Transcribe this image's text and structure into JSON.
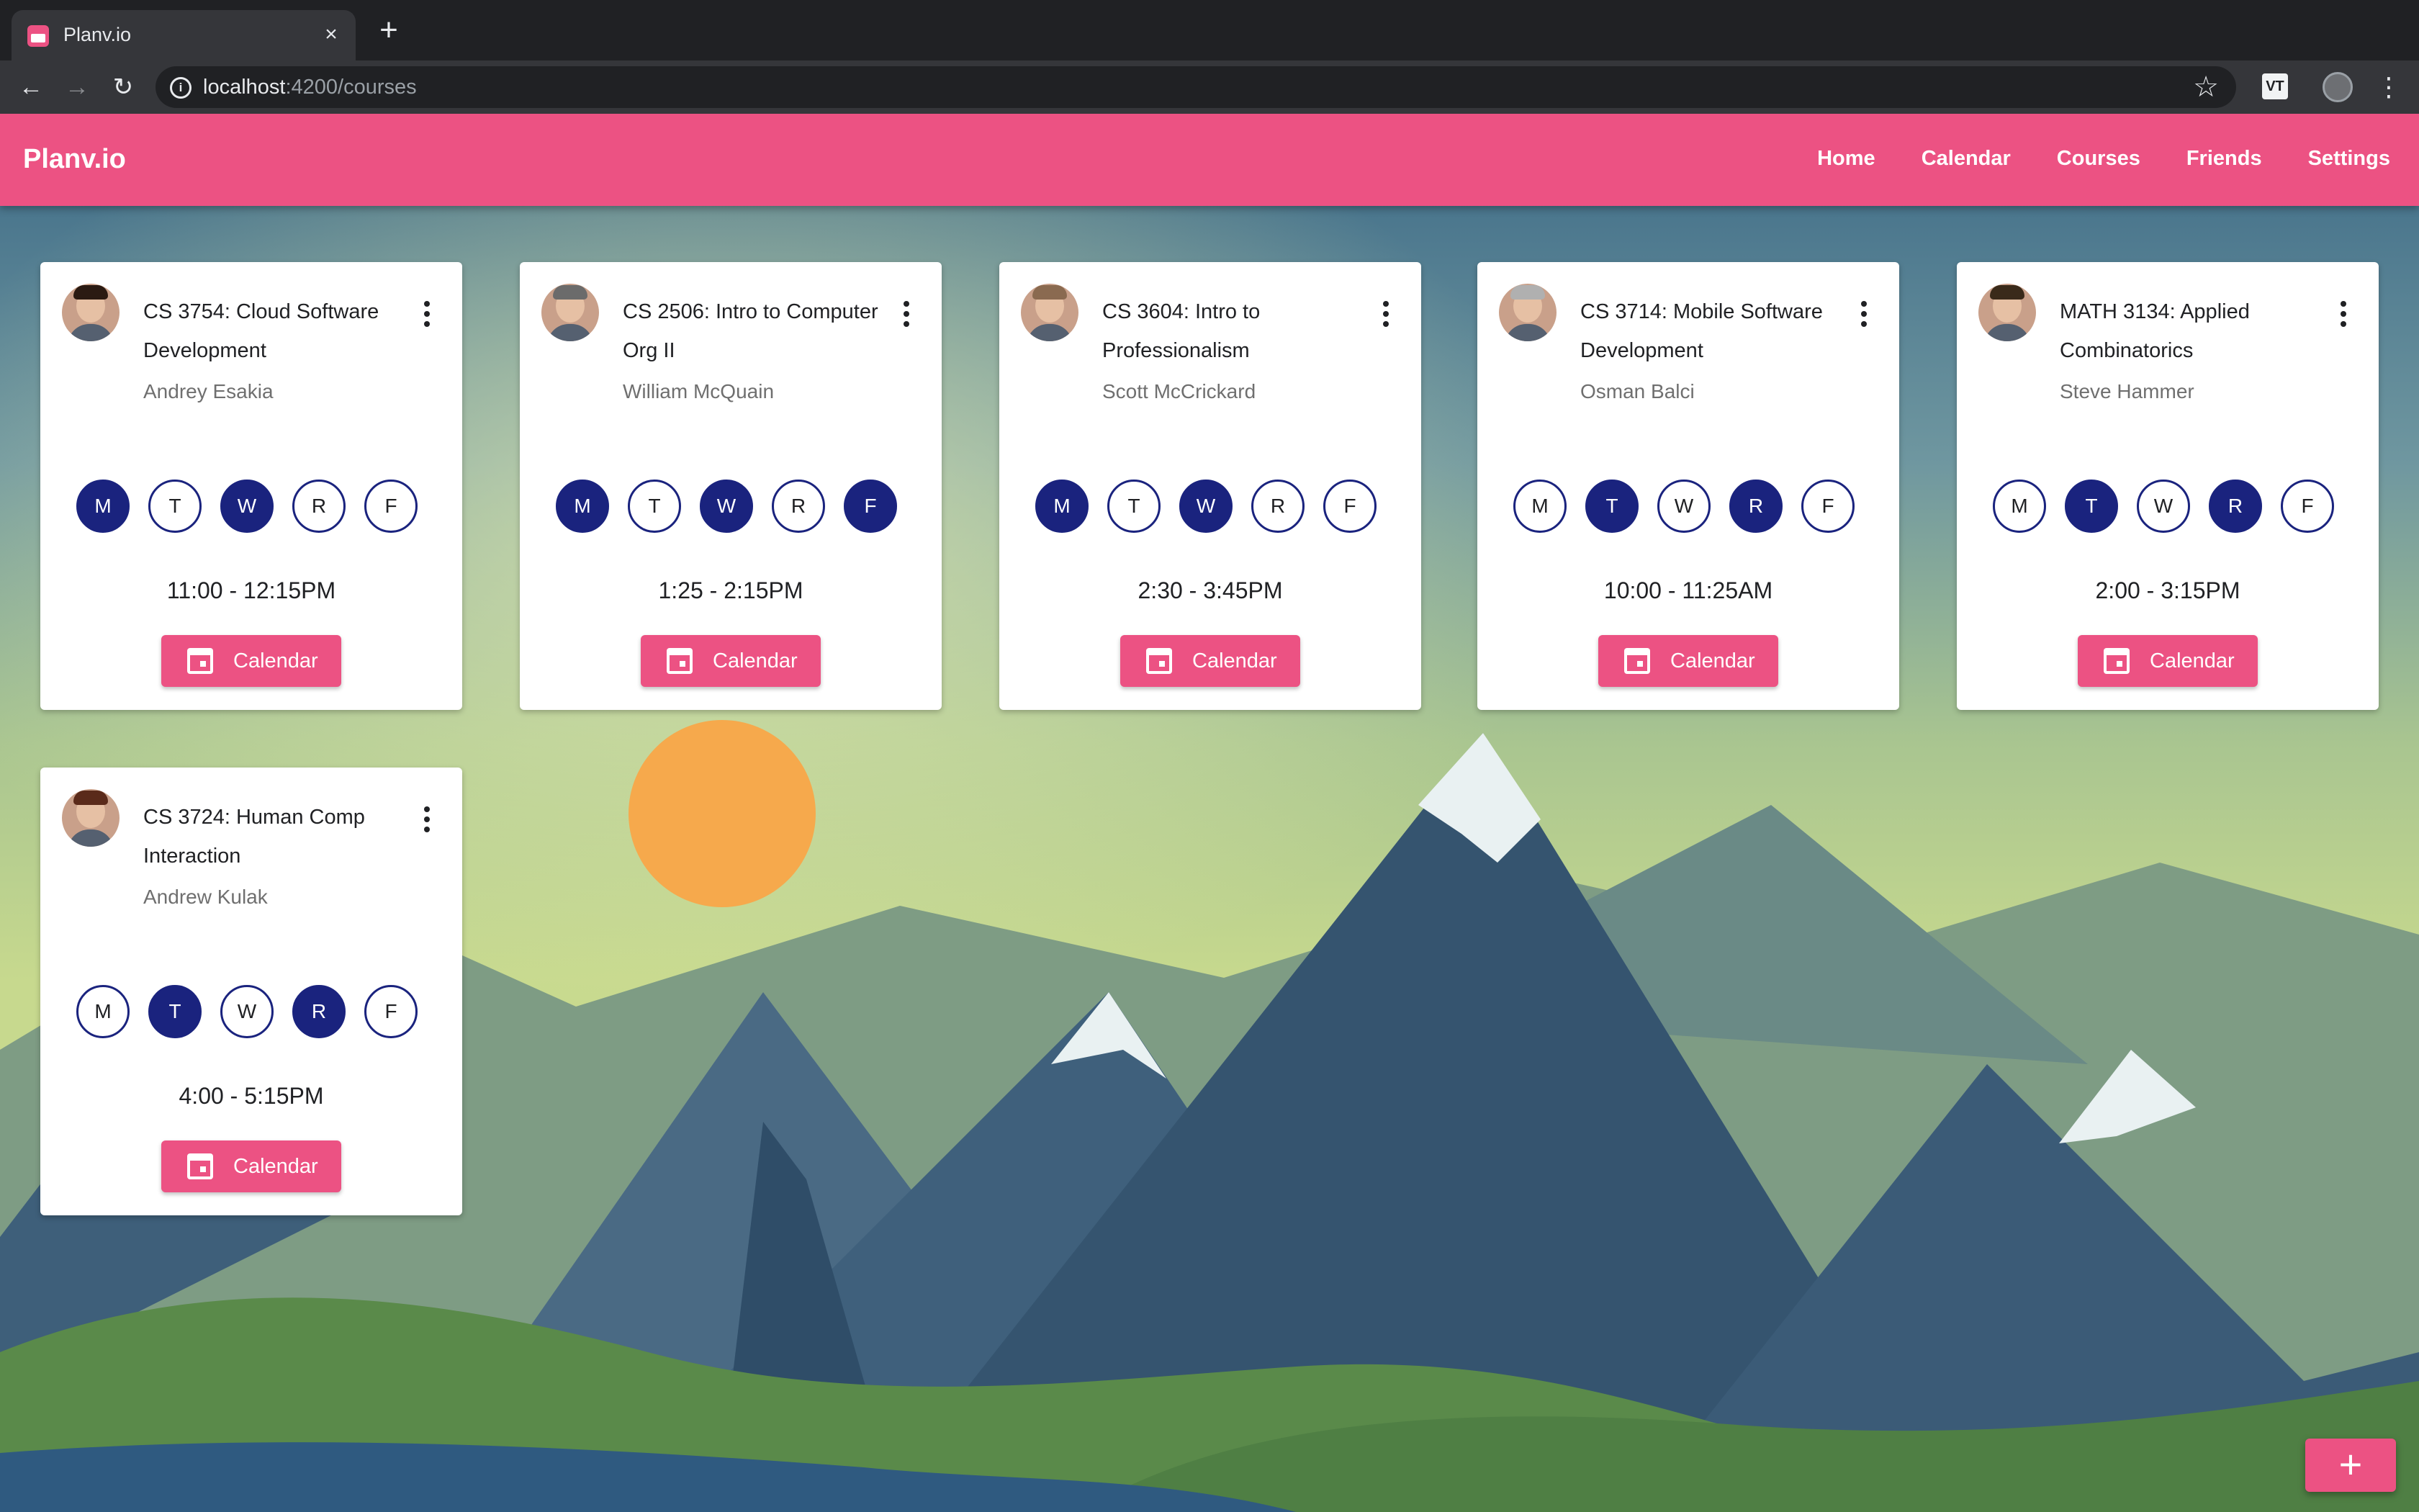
{
  "browser": {
    "tab_title": "Planv.io",
    "tab_close": "×",
    "new_tab": "+",
    "url_host": "localhost",
    "url_path": ":4200/courses",
    "ext_label": "VT"
  },
  "app": {
    "brand": "Planv.io",
    "nav": [
      "Home",
      "Calendar",
      "Courses",
      "Friends",
      "Settings"
    ],
    "colors": {
      "primary": "#ec5283",
      "day_active": "#1a237e"
    }
  },
  "days": [
    "M",
    "T",
    "W",
    "R",
    "F"
  ],
  "courses": [
    {
      "title": "CS 3754: Cloud Software Development",
      "instructor": "Andrey Esakia",
      "active_days": [
        true,
        false,
        true,
        false,
        false
      ],
      "time": "11:00 - 12:15PM",
      "button": "Calendar"
    },
    {
      "title": "CS 2506: Intro to Computer Org II",
      "instructor": "William McQuain",
      "active_days": [
        true,
        false,
        true,
        false,
        true
      ],
      "time": "1:25 - 2:15PM",
      "button": "Calendar"
    },
    {
      "title": "CS 3604: Intro to Professionalism",
      "instructor": "Scott McCrickard",
      "active_days": [
        true,
        false,
        true,
        false,
        false
      ],
      "time": "2:30 - 3:45PM",
      "button": "Calendar"
    },
    {
      "title": "CS 3714: Mobile Software Development",
      "instructor": "Osman Balci",
      "active_days": [
        false,
        true,
        false,
        true,
        false
      ],
      "time": "10:00 - 11:25AM",
      "button": "Calendar"
    },
    {
      "title": "MATH 3134: Applied Combinatorics",
      "instructor": "Steve Hammer",
      "active_days": [
        false,
        true,
        false,
        true,
        false
      ],
      "time": "2:00 - 3:15PM",
      "button": "Calendar"
    },
    {
      "title": "CS 3724: Human Comp Interaction",
      "instructor": "Andrew Kulak",
      "active_days": [
        false,
        true,
        false,
        true,
        false
      ],
      "time": "4:00 - 5:15PM",
      "button": "Calendar"
    }
  ],
  "fab_label": "+"
}
